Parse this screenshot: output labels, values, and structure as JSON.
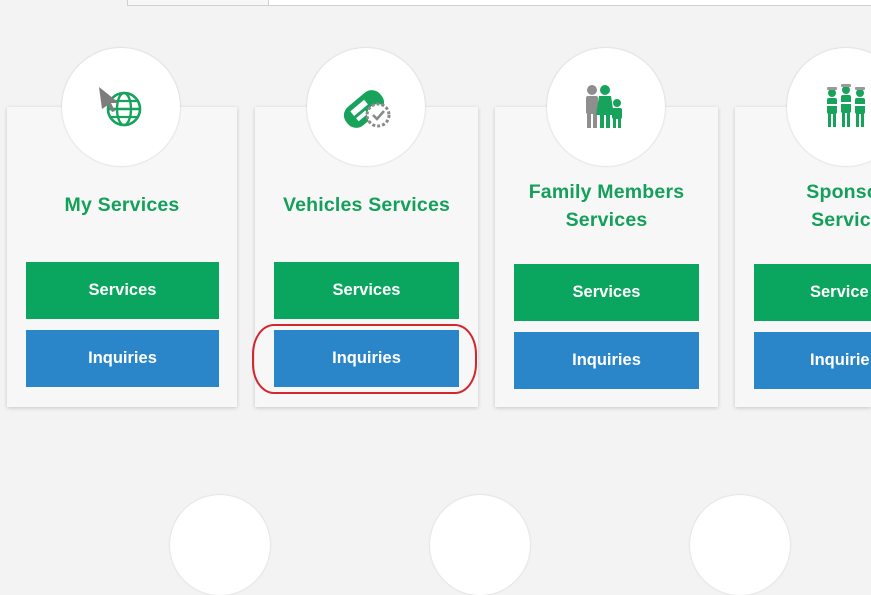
{
  "cards": [
    {
      "title": "My Services",
      "icon": "globe-cursor-icon",
      "services_label": "Services",
      "inquiries_label": "Inquiries"
    },
    {
      "title": "Vehicles Services",
      "icon": "vehicle-badge-icon",
      "services_label": "Services",
      "inquiries_label": "Inquiries"
    },
    {
      "title_line1": "Family Members",
      "title_line2": "Services",
      "icon": "family-icon",
      "services_label": "Services",
      "inquiries_label": "Inquiries"
    },
    {
      "title_line1": "Sponsor",
      "title_line2": "Service",
      "icon": "workers-icon",
      "services_label": "Service",
      "inquiries_label": "Inquirie"
    }
  ],
  "colors": {
    "title_green": "#14a05a",
    "services_button": "#0aa55e",
    "inquiries_button": "#2b86c9",
    "highlight_outline": "#d4262e"
  }
}
